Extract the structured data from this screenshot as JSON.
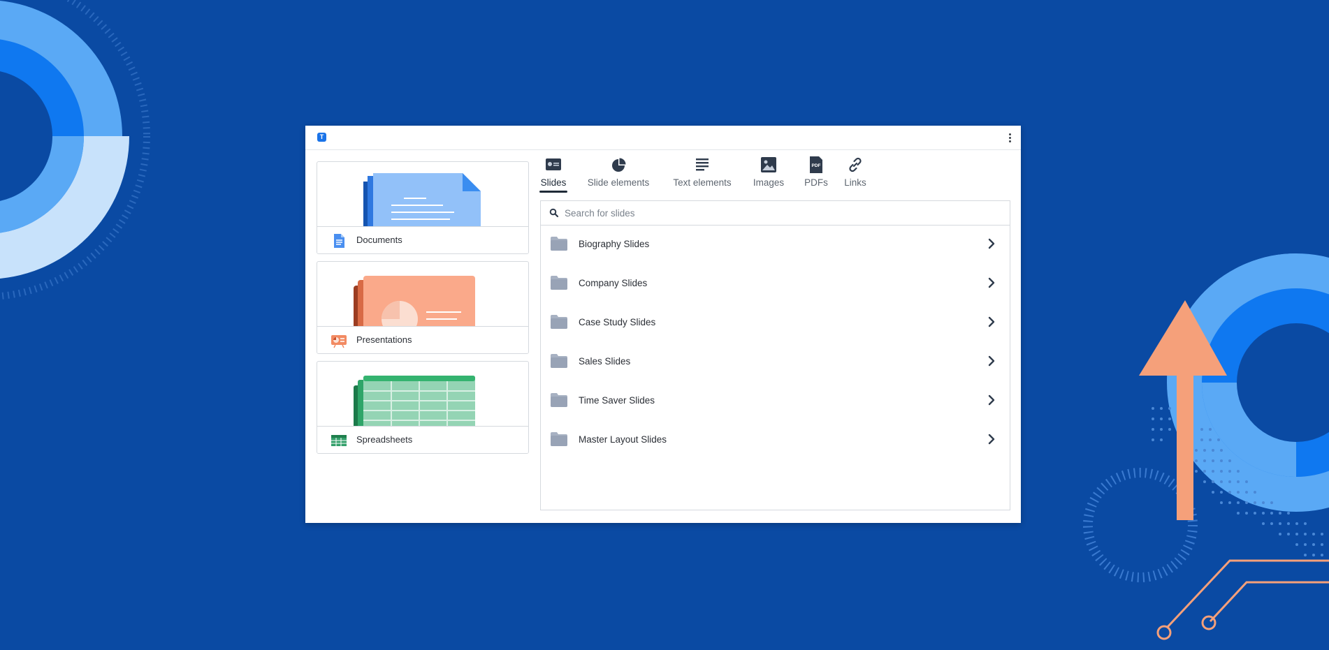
{
  "app": {
    "logo_letter": "T",
    "brand_color": "#1a73e8"
  },
  "categories": [
    {
      "label": "Documents",
      "icon": "document-icon",
      "color": "#4a8ff0"
    },
    {
      "label": "Presentations",
      "icon": "presentation-icon",
      "color": "#f28a62"
    },
    {
      "label": "Spreadsheets",
      "icon": "spreadsheet-icon",
      "color": "#34a06b"
    }
  ],
  "tabs": [
    {
      "label": "Slides",
      "icon": "slides-icon",
      "active": true
    },
    {
      "label": "Slide elements",
      "icon": "pie-chart-icon",
      "active": false
    },
    {
      "label": "Text elements",
      "icon": "text-lines-icon",
      "active": false
    },
    {
      "label": "Images",
      "icon": "image-icon",
      "active": false
    },
    {
      "label": "PDFs",
      "icon": "pdf-icon",
      "active": false
    },
    {
      "label": "Links",
      "icon": "link-icon",
      "active": false
    }
  ],
  "search": {
    "placeholder": "Search for slides",
    "value": ""
  },
  "folders": [
    {
      "label": "Biography Slides"
    },
    {
      "label": "Company Slides"
    },
    {
      "label": "Case Study Slides"
    },
    {
      "label": "Sales Slides"
    },
    {
      "label": "Time Saver Slides"
    },
    {
      "label": "Master Layout Slides"
    }
  ],
  "colors": {
    "background": "#0a4aa3",
    "accent_orange": "#f5a07a",
    "accent_light_blue": "#5aa9f5",
    "accent_blue": "#0f78f0",
    "folder_grey": "#a7b1c2",
    "text_dark": "#2b2f36"
  }
}
